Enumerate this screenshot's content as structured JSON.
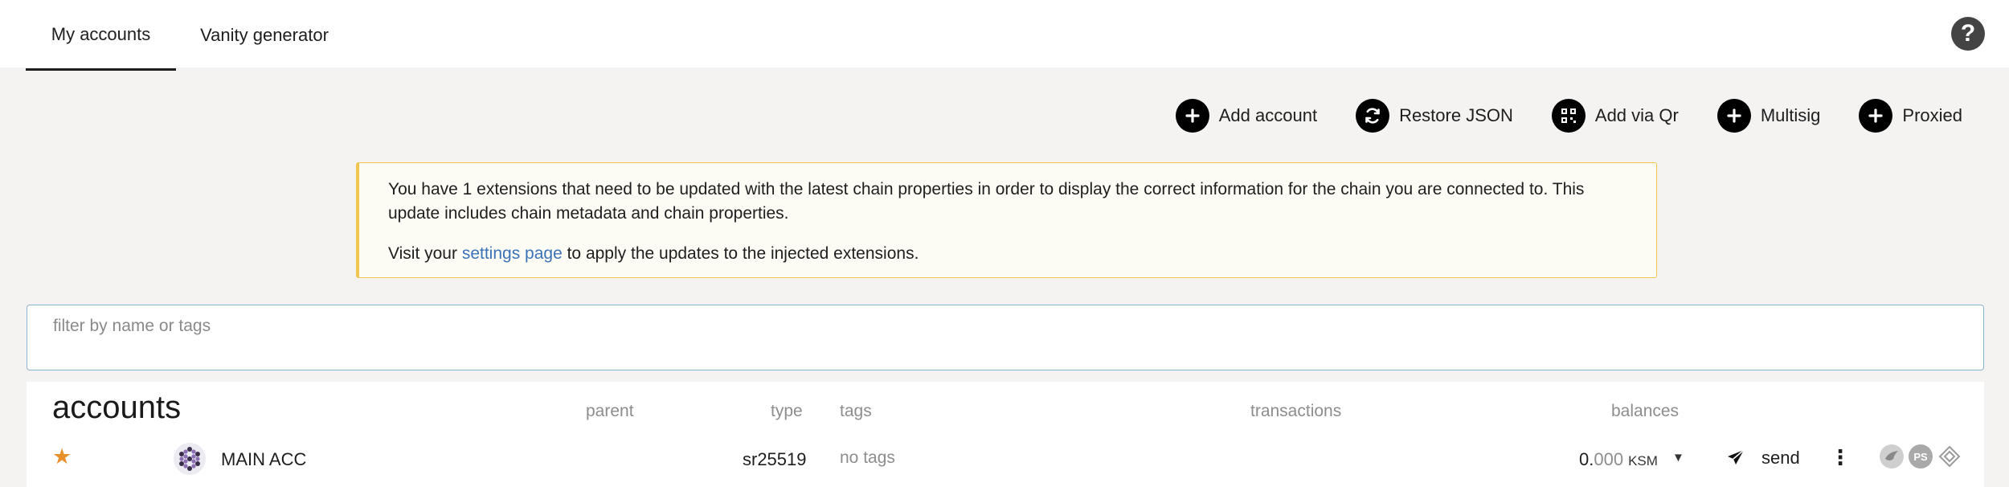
{
  "tabs": [
    {
      "label": "My accounts",
      "active": true
    },
    {
      "label": "Vanity generator",
      "active": false
    }
  ],
  "help_icon": "help-icon",
  "actions": [
    {
      "label": "Add account",
      "icon": "plus-icon"
    },
    {
      "label": "Restore JSON",
      "icon": "sync-icon"
    },
    {
      "label": "Add via Qr",
      "icon": "qrcode-icon"
    },
    {
      "label": "Multisig",
      "icon": "plus-icon"
    },
    {
      "label": "Proxied",
      "icon": "plus-icon"
    }
  ],
  "warning": {
    "text1": "You have 1 extensions that need to be updated with the latest chain properties in order to display the correct information for the chain you are connected to. This update includes chain metadata and chain properties.",
    "text2_prefix": "Visit your ",
    "link": "settings page",
    "text2_suffix": " to apply the updates to the injected extensions."
  },
  "filter": {
    "placeholder": "filter by name or tags",
    "value": ""
  },
  "table": {
    "title": "accounts",
    "headers": {
      "parent": "parent",
      "type": "type",
      "tags": "tags",
      "transactions": "transactions",
      "balances": "balances"
    },
    "rows": [
      {
        "favorite": true,
        "name": "MAIN ACC",
        "type": "sr25519",
        "tags": "no tags",
        "balance_int": "0.",
        "balance_dec": "000",
        "balance_unit": "KSM",
        "send_label": "send"
      }
    ]
  },
  "colors": {
    "accent_star": "#e8912b",
    "warning_border": "#f0c64e",
    "link": "#3c72b8",
    "page_bg": "#f4f3f2"
  }
}
